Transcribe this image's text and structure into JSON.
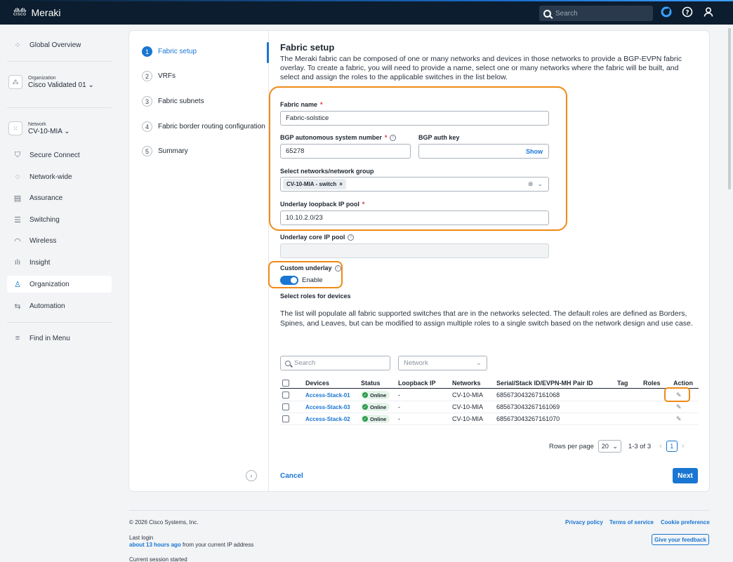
{
  "app": {
    "name": "Meraki",
    "logo_text": "cisco"
  },
  "topbar": {
    "search_placeholder": "Search"
  },
  "sidebar": {
    "global_overview": "Global Overview",
    "organization_label": "Organization",
    "organization_value": "Cisco Validated 01",
    "network_label": "Network",
    "network_value": "CV-10-MIA",
    "items": [
      {
        "label": "Secure Connect",
        "icon": "shield-icon"
      },
      {
        "label": "Network-wide",
        "icon": "network-icon"
      },
      {
        "label": "Assurance",
        "icon": "assurance-icon"
      },
      {
        "label": "Switching",
        "icon": "switch-icon"
      },
      {
        "label": "Wireless",
        "icon": "wifi-icon"
      },
      {
        "label": "Insight",
        "icon": "chart-icon"
      },
      {
        "label": "Organization",
        "icon": "organization-icon",
        "active": true
      },
      {
        "label": "Automation",
        "icon": "automation-icon"
      }
    ],
    "find_in_menu": "Find in Menu"
  },
  "steps": [
    {
      "num": "1",
      "label": "Fabric setup",
      "active": true
    },
    {
      "num": "2",
      "label": "VRFs"
    },
    {
      "num": "3",
      "label": "Fabric subnets"
    },
    {
      "num": "4",
      "label": "Fabric border routing configuration"
    },
    {
      "num": "5",
      "label": "Summary"
    }
  ],
  "form": {
    "title": "Fabric setup",
    "description": "The Meraki fabric can be composed of one or many networks and devices in those networks to provide a BGP-EVPN fabric overlay. To create a fabric, you will need to provide a name, select one or many networks where the fabric will be built, and select and assign the roles to the applicable switches in the list below.",
    "fabric_name_label": "Fabric name",
    "fabric_name_value": "Fabric-solstice",
    "bgp_asn_label": "BGP autonomous system number",
    "bgp_asn_value": "65278",
    "bgp_auth_label": "BGP auth key",
    "bgp_auth_show": "Show",
    "networks_label": "Select networks/network group",
    "networks_chip": "CV-10-MIA - switch",
    "loopback_label": "Underlay loopback IP pool",
    "loopback_value": "10.10.2.0/23",
    "core_label": "Underlay core IP pool",
    "custom_underlay_label": "Custom underlay",
    "enable_label": "Enable",
    "roles_heading": "Select roles for devices",
    "roles_text": "The list will populate all fabric supported switches that are in the networks selected. The default roles are defined as Borders, Spines, and Leaves, but can be modified to assign multiple roles to a single switch based on the network design and use case."
  },
  "table": {
    "search_placeholder": "Search",
    "network_filter": "Network",
    "columns": [
      "Devices",
      "Status",
      "Loopback IP",
      "Networks",
      "Serial/Stack ID/EVPN-MH Pair ID",
      "Tag",
      "Roles",
      "Action"
    ],
    "rows": [
      {
        "device": "Access-Stack-01",
        "status": "Online",
        "loopback": "-",
        "network": "CV-10-MIA",
        "serial": "685673043267161068"
      },
      {
        "device": "Access-Stack-03",
        "status": "Online",
        "loopback": "-",
        "network": "CV-10-MIA",
        "serial": "685673043267161069"
      },
      {
        "device": "Access-Stack-02",
        "status": "Online",
        "loopback": "-",
        "network": "CV-10-MIA",
        "serial": "685673043267161070"
      }
    ],
    "rows_per_page_label": "Rows per page",
    "rows_per_page_value": "20",
    "range": "1-3 of 3",
    "page": "1"
  },
  "actions": {
    "cancel": "Cancel",
    "next": "Next"
  },
  "footer": {
    "copyright": "© 2026 Cisco Systems, Inc.",
    "last_login_label": "Last login",
    "last_login_time": "about 13 hours ago",
    "last_login_suffix": "from your current IP address",
    "session": "Current session started",
    "privacy": "Privacy policy",
    "terms": "Terms of service",
    "cookie": "Cookie preference",
    "feedback": "Give your feedback"
  },
  "colors": {
    "accent": "#1976d2",
    "highlight": "#ef8a17",
    "topbar": "#0b1d2e",
    "online": "#2e9b4f"
  }
}
